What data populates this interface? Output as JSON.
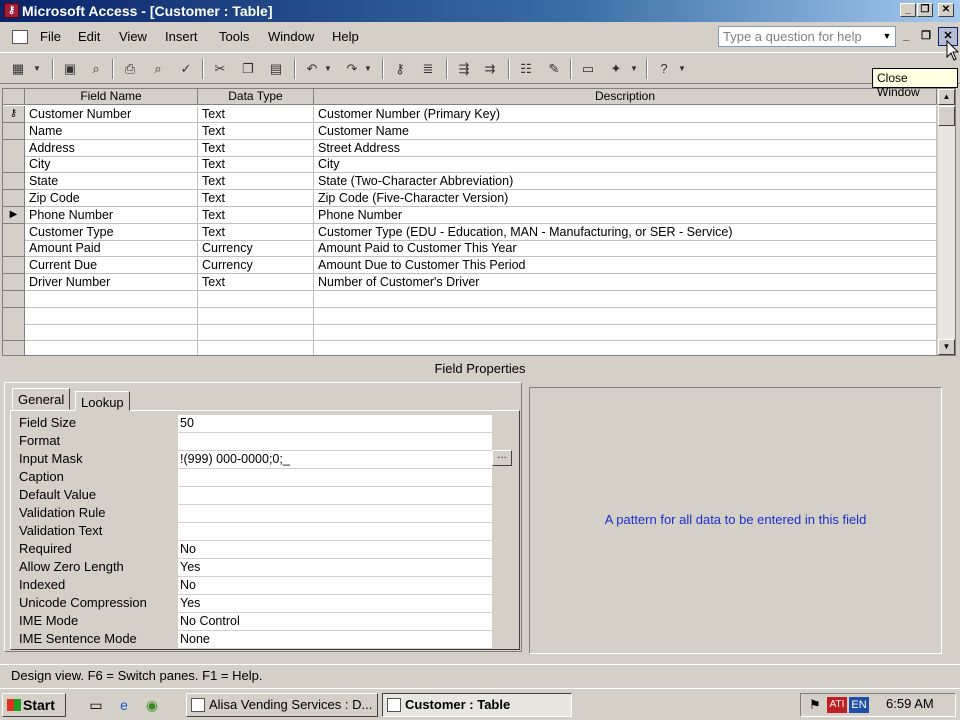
{
  "window": {
    "title": "Microsoft Access - [Customer : Table]",
    "app_icon": "access-icon"
  },
  "menu": {
    "items": [
      "File",
      "Edit",
      "View",
      "Insert",
      "Tools",
      "Window",
      "Help"
    ],
    "help_placeholder": "Type a question for help"
  },
  "tooltip": "Close Window",
  "grid": {
    "headers": [
      "Field Name",
      "Data Type",
      "Description"
    ],
    "rows": [
      {
        "field": "Customer Number",
        "type": "Text",
        "desc": "Customer Number (Primary Key)"
      },
      {
        "field": "Name",
        "type": "Text",
        "desc": "Customer Name"
      },
      {
        "field": "Address",
        "type": "Text",
        "desc": "Street Address"
      },
      {
        "field": "City",
        "type": "Text",
        "desc": "City"
      },
      {
        "field": "State",
        "type": "Text",
        "desc": "State (Two-Character Abbreviation)"
      },
      {
        "field": "Zip Code",
        "type": "Text",
        "desc": "Zip Code (Five-Character Version)"
      },
      {
        "field": "Phone Number",
        "type": "Text",
        "desc": "Phone Number"
      },
      {
        "field": "Customer Type",
        "type": "Text",
        "desc": "Customer Type (EDU - Education, MAN - Manufacturing, or SER - Service)"
      },
      {
        "field": "Amount Paid",
        "type": "Currency",
        "desc": "Amount Paid to Customer This Year"
      },
      {
        "field": "Current Due",
        "type": "Currency",
        "desc": "Amount Due to Customer This Period"
      },
      {
        "field": "Driver Number",
        "type": "Text",
        "desc": "Number of Customer's Driver"
      }
    ]
  },
  "field_properties": {
    "title": "Field Properties",
    "tabs": [
      "General",
      "Lookup"
    ],
    "props": [
      {
        "label": "Field Size",
        "value": "50"
      },
      {
        "label": "Format",
        "value": ""
      },
      {
        "label": "Input Mask",
        "value": "!(999) 000-0000;0;_"
      },
      {
        "label": "Caption",
        "value": ""
      },
      {
        "label": "Default Value",
        "value": ""
      },
      {
        "label": "Validation Rule",
        "value": ""
      },
      {
        "label": "Validation Text",
        "value": ""
      },
      {
        "label": "Required",
        "value": "No"
      },
      {
        "label": "Allow Zero Length",
        "value": "Yes"
      },
      {
        "label": "Indexed",
        "value": "No"
      },
      {
        "label": "Unicode Compression",
        "value": "Yes"
      },
      {
        "label": "IME Mode",
        "value": "No Control"
      },
      {
        "label": "IME Sentence Mode",
        "value": "None"
      }
    ],
    "help_text": "A pattern for all data to be entered in this field"
  },
  "status": "Design view.  F6 = Switch panes.  F1 = Help.",
  "taskbar": {
    "start": "Start",
    "tasks": [
      "Alisa Vending Services : D...",
      "Customer : Table"
    ],
    "lang": "EN",
    "clock": "6:59 AM"
  }
}
